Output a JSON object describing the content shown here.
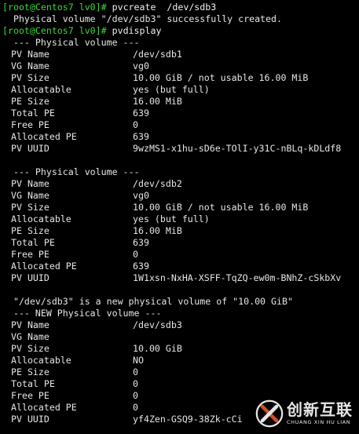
{
  "terminal": {
    "prompt": "[root@Centos7 lv0]#",
    "cmd1": " pvcreate  /dev/sdb3",
    "output1": "  Physical volume \"/dev/sdb3\" successfully created.",
    "cmd2": " pvdisplay",
    "pv1": {
      "header": "  --- Physical volume ---",
      "fields": [
        {
          "key": "PV Name",
          "value": "/dev/sdb1"
        },
        {
          "key": "VG Name",
          "value": "vg0"
        },
        {
          "key": "PV Size",
          "value": "10.00 GiB / not usable 16.00 MiB"
        },
        {
          "key": "Allocatable",
          "value": "yes (but full)"
        },
        {
          "key": "PE Size",
          "value": "16.00 MiB"
        },
        {
          "key": "Total PE",
          "value": "639"
        },
        {
          "key": "Free PE",
          "value": "0"
        },
        {
          "key": "Allocated PE",
          "value": "639"
        },
        {
          "key": "PV UUID",
          "value": "9wzMS1-x1hu-sD6e-TOlI-y31C-nBLq-kDLdf8"
        }
      ]
    },
    "pv2": {
      "header": "  --- Physical volume ---",
      "fields": [
        {
          "key": "PV Name",
          "value": "/dev/sdb2"
        },
        {
          "key": "VG Name",
          "value": "vg0"
        },
        {
          "key": "PV Size",
          "value": "10.00 GiB / not usable 16.00 MiB"
        },
        {
          "key": "Allocatable",
          "value": "yes (but full)"
        },
        {
          "key": "PE Size",
          "value": "16.00 MiB"
        },
        {
          "key": "Total PE",
          "value": "639"
        },
        {
          "key": "Free PE",
          "value": "0"
        },
        {
          "key": "Allocated PE",
          "value": "639"
        },
        {
          "key": "PV UUID",
          "value": "1W1xsn-NxHA-XSFF-TqZQ-ew0m-BNhZ-cSkbXv"
        }
      ]
    },
    "new_msg": "  \"/dev/sdb3\" is a new physical volume of \"10.00 GiB\"",
    "pv3": {
      "header": "  --- NEW Physical volume ---",
      "fields": [
        {
          "key": "PV Name",
          "value": "/dev/sdb3"
        },
        {
          "key": "VG Name",
          "value": ""
        },
        {
          "key": "PV Size",
          "value": "10.00 GiB"
        },
        {
          "key": "Allocatable",
          "value": "NO"
        },
        {
          "key": "PE Size",
          "value": "0"
        },
        {
          "key": "Total PE",
          "value": "0"
        },
        {
          "key": "Free PE",
          "value": "0"
        },
        {
          "key": "Allocated PE",
          "value": "0"
        },
        {
          "key": "PV UUID",
          "value": "yf4Zen-GSQ9-38Zk-cCi"
        }
      ]
    }
  },
  "watermark": {
    "title": "创新互联",
    "subtitle": "CHUANG XIN HU LIAN",
    "logo_icon": "creative-x-logo-icon"
  },
  "colors": {
    "background": "#000000",
    "text": "#e6e6e6",
    "prompt": "#39d739"
  }
}
